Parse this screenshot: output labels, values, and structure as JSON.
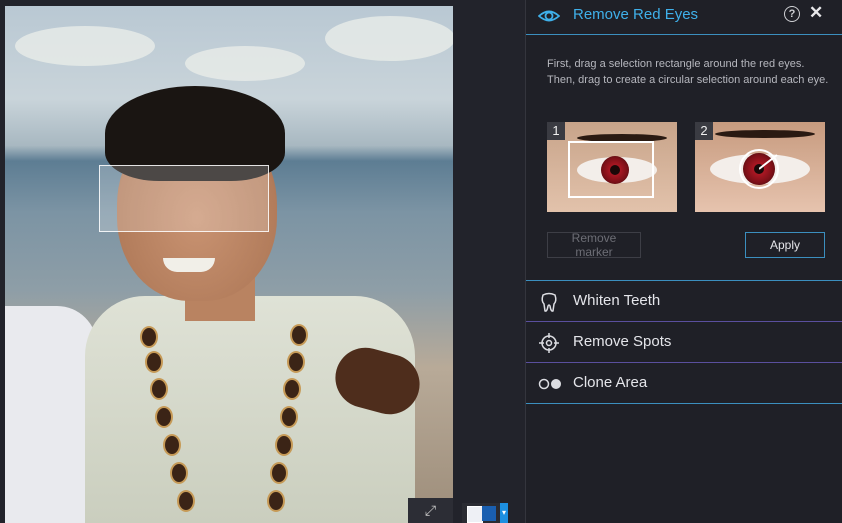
{
  "panel": {
    "title": "Remove Red Eyes",
    "help_icon": "question-circle-icon",
    "close_icon": "close-icon",
    "help_glyph": "?",
    "close_glyph": "✕",
    "instructions": "First, drag a selection rectangle around the red eyes. Then, drag to create a circular selection around each eye.",
    "steps": [
      {
        "number": "1"
      },
      {
        "number": "2"
      }
    ],
    "remove_marker_label": "Remove marker",
    "apply_label": "Apply"
  },
  "tools": [
    {
      "label": "Whiten Teeth",
      "icon": "tooth-icon"
    },
    {
      "label": "Remove Spots",
      "icon": "crosshair-icon"
    },
    {
      "label": "Clone Area",
      "icon": "clone-icon"
    }
  ],
  "canvas": {
    "expand_glyph": "⤢"
  },
  "colors": {
    "accent": "#3fb0ea",
    "panel_bg": "#1f2027",
    "divider_blue": "#3b8fbf",
    "divider_purple": "#5a4f9e"
  }
}
